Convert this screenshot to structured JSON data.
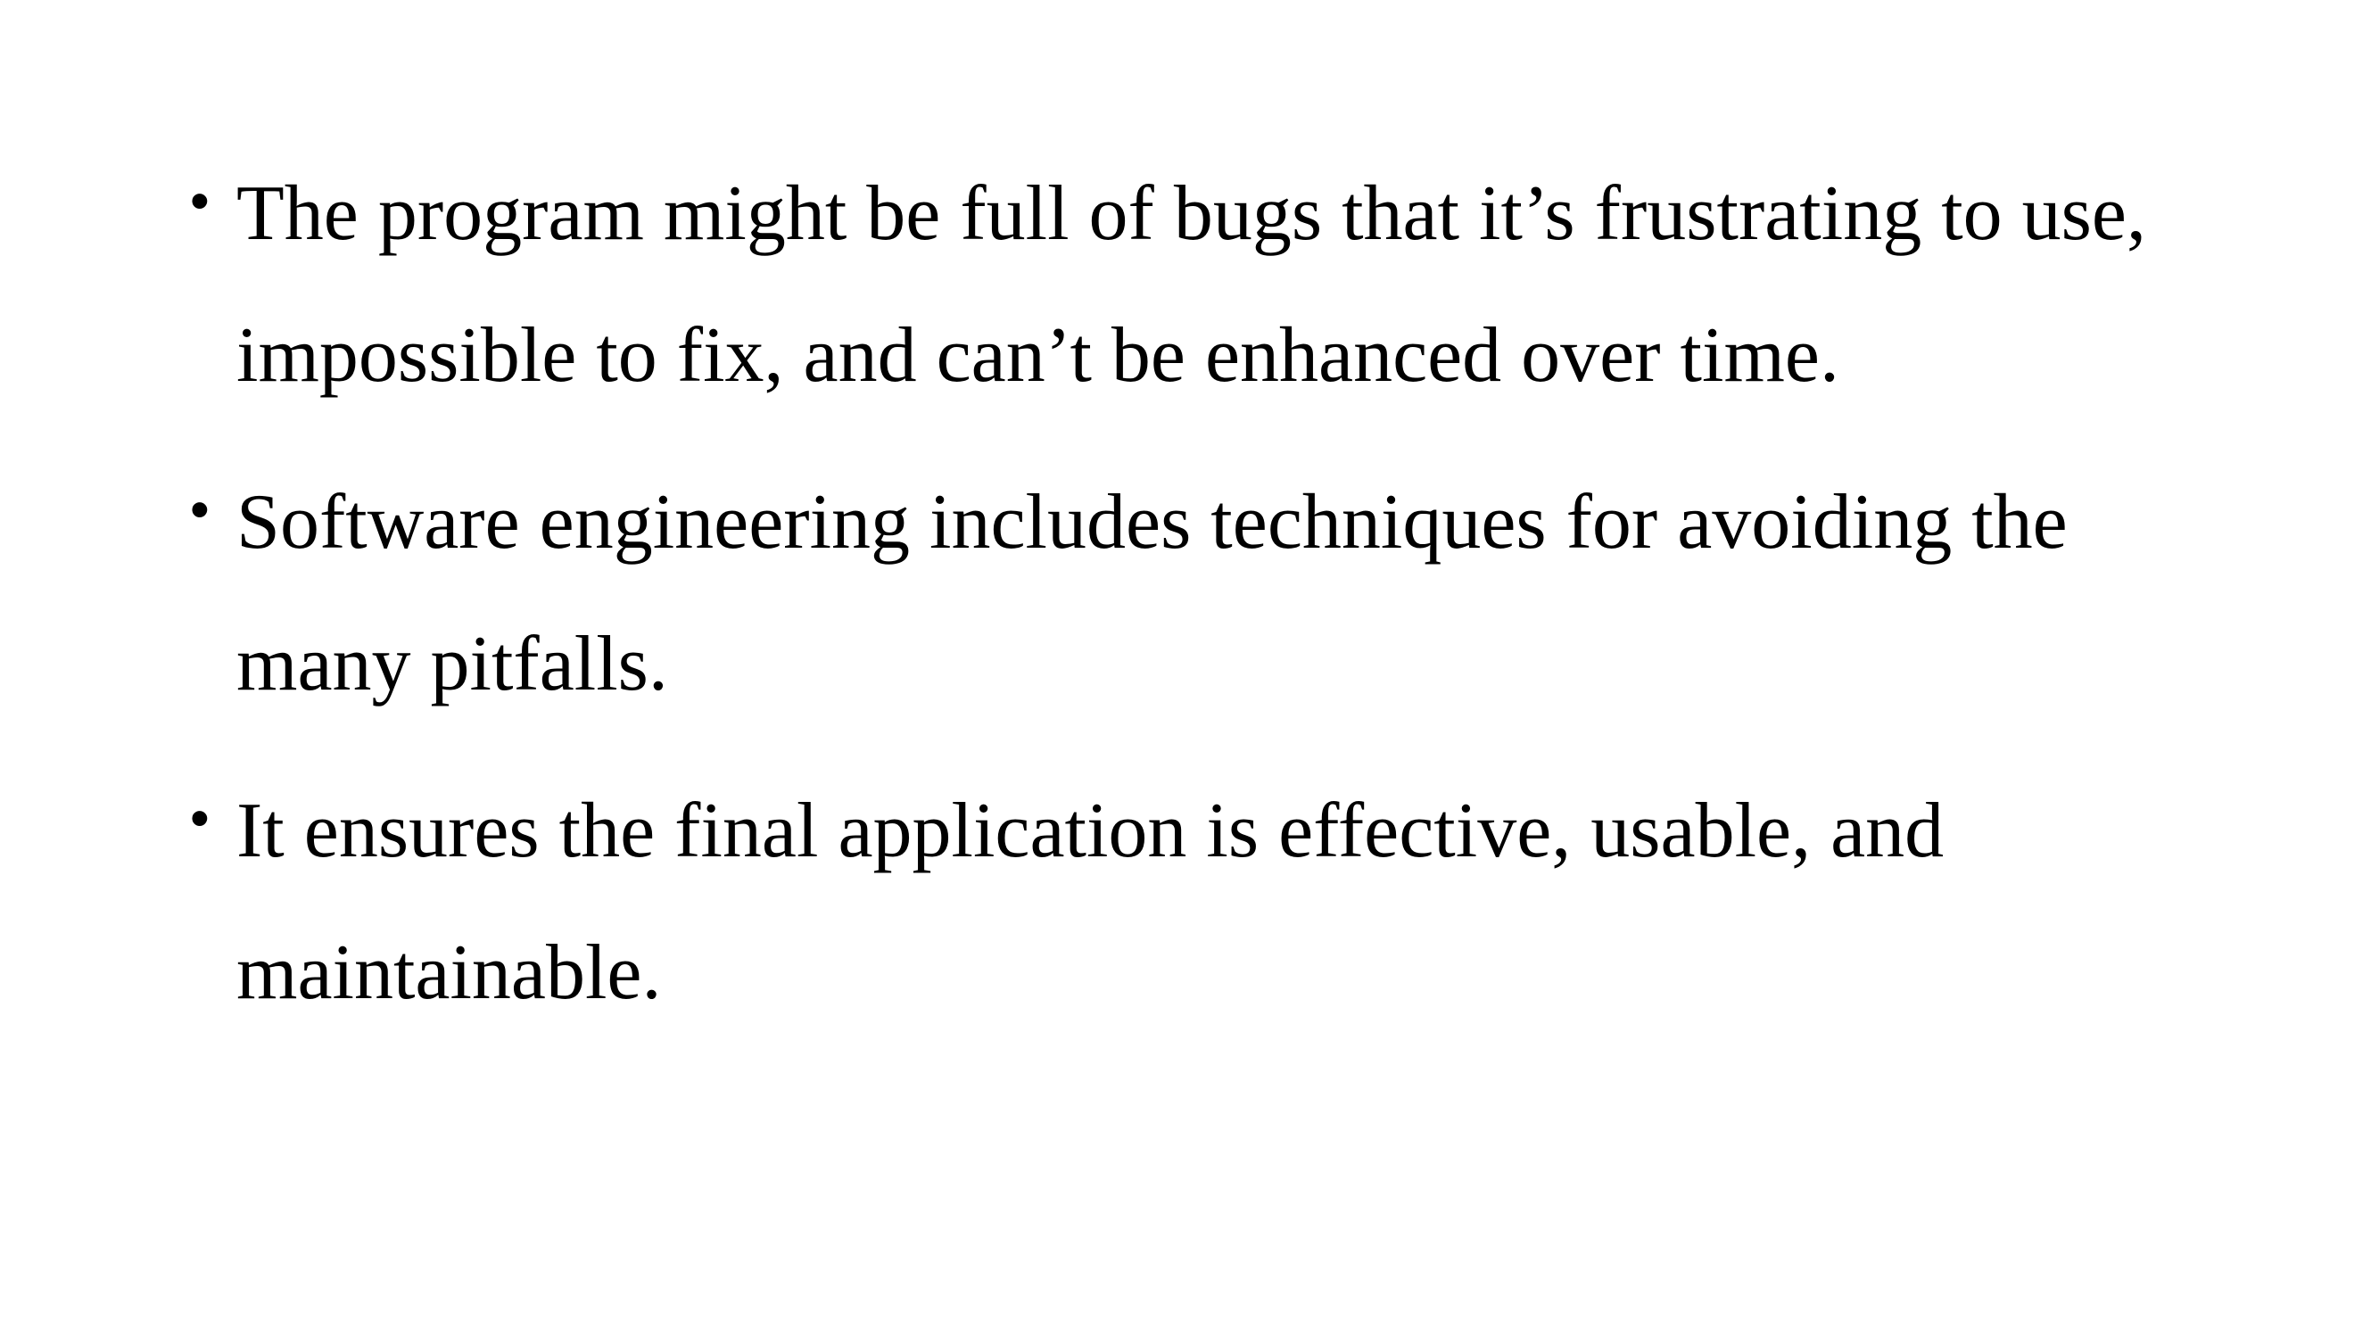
{
  "slide": {
    "bullets": [
      {
        "marker": "•",
        "lines": [
          "The program might be full of bugs that it’s frustrating to use,",
          "impossible to fix, and can’t be enhanced over time."
        ]
      },
      {
        "marker": "•",
        "lines": [
          "Software engineering includes techniques for avoiding the",
          "many pitfalls."
        ]
      },
      {
        "marker": "•",
        "lines": [
          "It ensures the final application is effective, usable, and",
          "maintainable."
        ]
      }
    ]
  }
}
